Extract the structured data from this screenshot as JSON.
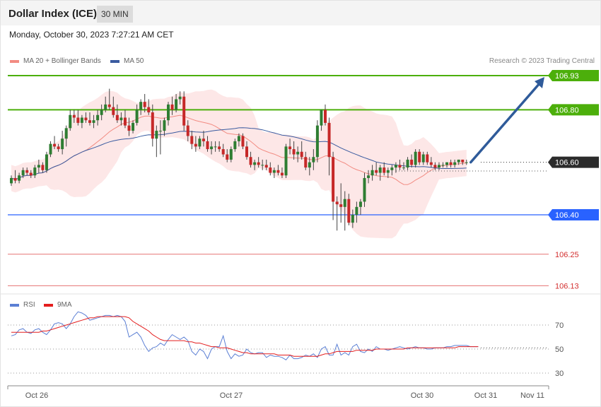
{
  "header": {
    "title": "Dollar Index (ICE)",
    "timeframe": "30 MIN"
  },
  "timestamp": "Monday, October 30, 2023 7:27:21 AM CET",
  "credit": "Research © 2023 Trading Central",
  "legend_main": [
    {
      "label": "MA 20 + Bollinger Bands",
      "color": "#f28b82"
    },
    {
      "label": "MA 50",
      "color": "#3a5ba0"
    }
  ],
  "legend_rsi": [
    {
      "label": "RSI",
      "color": "#5b7fd4"
    },
    {
      "label": "9MA",
      "color": "#e41e1e"
    }
  ],
  "colors": {
    "up": "#2e7d32",
    "down": "#c62828",
    "resistance": "#4caf0b",
    "support": "#2962ff",
    "target_line": "#e57373",
    "current": "#333333",
    "arrow": "#2f5b9a",
    "band": "#fde3e3"
  },
  "chart_data": [
    {
      "type": "candlestick",
      "ylim": [
        106.05,
        107.0
      ],
      "x_ticks": [
        "Oct 26",
        "Oct 27",
        "Oct 30",
        "Oct 31",
        "Nov 11"
      ],
      "levels": [
        {
          "label": "106.93",
          "value": 106.93,
          "kind": "resistance"
        },
        {
          "label": "106.80",
          "value": 106.8,
          "kind": "resistance"
        },
        {
          "label": "106.60",
          "value": 106.6,
          "kind": "current"
        },
        {
          "label": "106.40",
          "value": 106.4,
          "kind": "support"
        },
        {
          "label": "106.25",
          "value": 106.25,
          "kind": "target"
        },
        {
          "label": "106.13",
          "value": 106.13,
          "kind": "target"
        }
      ],
      "arrow": {
        "from_value": 106.6,
        "to_value": 106.93
      },
      "candles": [
        [
          106.52,
          106.55,
          106.51,
          106.54
        ],
        [
          106.54,
          106.57,
          106.52,
          106.53
        ],
        [
          106.53,
          106.56,
          106.52,
          106.55
        ],
        [
          106.55,
          106.58,
          106.54,
          106.57
        ],
        [
          106.57,
          106.58,
          106.55,
          106.56
        ],
        [
          106.56,
          106.57,
          106.54,
          106.55
        ],
        [
          106.55,
          106.59,
          106.54,
          106.58
        ],
        [
          106.58,
          106.61,
          106.56,
          106.59
        ],
        [
          106.59,
          106.6,
          106.56,
          106.57
        ],
        [
          106.57,
          106.64,
          106.56,
          106.63
        ],
        [
          106.63,
          106.68,
          106.62,
          106.67
        ],
        [
          106.67,
          106.7,
          106.65,
          106.66
        ],
        [
          106.66,
          106.67,
          106.64,
          106.65
        ],
        [
          106.65,
          106.72,
          106.63,
          106.69
        ],
        [
          106.69,
          106.74,
          106.66,
          106.73
        ],
        [
          106.73,
          106.8,
          106.72,
          106.78
        ],
        [
          106.78,
          106.8,
          106.75,
          106.77
        ],
        [
          106.77,
          106.8,
          106.74,
          106.75
        ],
        [
          106.75,
          106.78,
          106.73,
          106.77
        ],
        [
          106.77,
          106.79,
          106.75,
          106.76
        ],
        [
          106.76,
          106.79,
          106.74,
          106.75
        ],
        [
          106.75,
          106.78,
          106.73,
          106.76
        ],
        [
          106.76,
          106.8,
          106.74,
          106.78
        ],
        [
          106.78,
          106.82,
          106.76,
          106.8
        ],
        [
          106.8,
          106.85,
          106.79,
          106.82
        ],
        [
          106.82,
          106.88,
          106.8,
          106.81
        ],
        [
          106.81,
          106.85,
          106.77,
          106.78
        ],
        [
          106.78,
          106.82,
          106.75,
          106.76
        ],
        [
          106.76,
          106.79,
          106.74,
          106.77
        ],
        [
          106.77,
          106.8,
          106.73,
          106.74
        ],
        [
          106.74,
          106.77,
          106.7,
          106.72
        ],
        [
          106.72,
          106.76,
          106.71,
          106.75
        ],
        [
          106.75,
          106.82,
          106.74,
          106.8
        ],
        [
          106.8,
          106.84,
          106.78,
          106.83
        ],
        [
          106.83,
          106.86,
          106.79,
          106.81
        ],
        [
          106.81,
          106.84,
          106.78,
          106.79
        ],
        [
          106.79,
          106.82,
          106.66,
          106.69
        ],
        [
          106.69,
          106.74,
          106.62,
          106.72
        ],
        [
          106.72,
          106.76,
          106.63,
          106.72
        ],
        [
          106.72,
          106.77,
          106.7,
          106.76
        ],
        [
          106.76,
          106.83,
          106.74,
          106.82
        ],
        [
          106.82,
          106.85,
          106.78,
          106.8
        ],
        [
          106.8,
          106.86,
          106.79,
          106.84
        ],
        [
          106.84,
          106.87,
          106.82,
          106.85
        ],
        [
          106.85,
          106.87,
          106.72,
          106.74
        ],
        [
          106.74,
          106.76,
          106.68,
          106.7
        ],
        [
          106.7,
          106.72,
          106.65,
          106.67
        ],
        [
          106.67,
          106.7,
          106.64,
          106.66
        ],
        [
          106.66,
          106.7,
          106.65,
          106.69
        ],
        [
          106.69,
          106.72,
          106.66,
          106.68
        ],
        [
          106.68,
          106.7,
          106.64,
          106.65
        ],
        [
          106.65,
          106.68,
          106.63,
          106.66
        ],
        [
          106.66,
          106.68,
          106.64,
          106.66
        ],
        [
          106.66,
          106.68,
          106.64,
          106.65
        ],
        [
          106.65,
          106.67,
          106.62,
          106.63
        ],
        [
          106.63,
          106.65,
          106.6,
          106.61
        ],
        [
          106.61,
          106.66,
          106.6,
          106.65
        ],
        [
          106.65,
          106.69,
          106.64,
          106.68
        ],
        [
          106.68,
          106.71,
          106.66,
          106.7
        ],
        [
          106.7,
          106.71,
          106.65,
          106.66
        ],
        [
          106.66,
          106.68,
          106.61,
          106.62
        ],
        [
          106.62,
          106.64,
          106.58,
          106.59
        ],
        [
          106.59,
          106.61,
          106.57,
          106.6
        ],
        [
          106.6,
          106.62,
          106.58,
          106.59
        ],
        [
          106.59,
          106.61,
          106.57,
          106.59
        ],
        [
          106.59,
          106.61,
          106.57,
          106.58
        ],
        [
          106.58,
          106.6,
          106.55,
          106.56
        ],
        [
          106.56,
          106.58,
          106.54,
          106.57
        ],
        [
          106.57,
          106.59,
          106.55,
          106.56
        ],
        [
          106.56,
          106.58,
          106.54,
          106.55
        ],
        [
          106.55,
          106.67,
          106.54,
          106.66
        ],
        [
          106.66,
          106.69,
          106.63,
          106.65
        ],
        [
          106.65,
          106.68,
          106.61,
          106.63
        ],
        [
          106.63,
          106.66,
          106.6,
          106.64
        ],
        [
          106.64,
          106.68,
          106.61,
          106.62
        ],
        [
          106.62,
          106.64,
          106.57,
          106.58
        ],
        [
          106.58,
          106.62,
          106.55,
          106.6
        ],
        [
          106.6,
          106.65,
          106.57,
          106.62
        ],
        [
          106.62,
          106.76,
          106.6,
          106.74
        ],
        [
          106.74,
          106.8,
          106.72,
          106.8
        ],
        [
          106.8,
          106.82,
          106.74,
          106.75
        ],
        [
          106.75,
          106.77,
          106.55,
          106.62
        ],
        [
          106.62,
          106.64,
          106.38,
          106.45
        ],
        [
          106.45,
          106.47,
          106.34,
          106.44
        ],
        [
          106.44,
          106.52,
          106.37,
          106.43
        ],
        [
          106.43,
          106.49,
          106.34,
          106.46
        ],
        [
          106.46,
          106.48,
          106.36,
          106.37
        ],
        [
          106.37,
          106.42,
          106.35,
          106.4
        ],
        [
          106.4,
          106.45,
          106.37,
          106.43
        ],
        [
          106.43,
          106.46,
          106.4,
          106.45
        ],
        [
          106.45,
          106.56,
          106.43,
          106.54
        ],
        [
          106.54,
          106.57,
          106.52,
          106.55
        ],
        [
          106.55,
          106.59,
          106.53,
          106.57
        ],
        [
          106.57,
          106.6,
          106.55,
          106.56
        ],
        [
          106.56,
          106.59,
          106.53,
          106.58
        ],
        [
          106.58,
          106.6,
          106.55,
          106.56
        ],
        [
          106.56,
          106.58,
          106.54,
          106.57
        ],
        [
          106.57,
          106.59,
          106.55,
          106.58
        ],
        [
          106.58,
          106.6,
          106.56,
          106.59
        ],
        [
          106.59,
          106.61,
          106.57,
          106.58
        ],
        [
          106.58,
          106.6,
          106.57,
          106.58
        ],
        [
          106.58,
          106.62,
          106.57,
          106.61
        ],
        [
          106.61,
          106.63,
          106.58,
          106.59
        ],
        [
          106.59,
          106.65,
          106.58,
          106.64
        ],
        [
          106.64,
          106.65,
          106.59,
          106.6
        ],
        [
          106.6,
          106.64,
          106.59,
          106.63
        ],
        [
          106.63,
          106.64,
          106.59,
          106.6
        ],
        [
          106.6,
          106.62,
          106.58,
          106.59
        ],
        [
          106.59,
          106.6,
          106.57,
          106.58
        ],
        [
          106.58,
          106.6,
          106.57,
          106.59
        ],
        [
          106.59,
          106.6,
          106.58,
          106.59
        ],
        [
          106.59,
          106.6,
          106.58,
          106.6
        ],
        [
          106.6,
          106.61,
          106.58,
          106.59
        ],
        [
          106.59,
          106.61,
          106.58,
          106.6
        ],
        [
          106.6,
          106.61,
          106.59,
          106.61
        ],
        [
          106.61,
          106.61,
          106.59,
          106.6
        ],
        [
          106.6,
          106.61,
          106.59,
          106.6
        ]
      ]
    },
    {
      "type": "line",
      "name": "RSI",
      "ylim": [
        20,
        85
      ],
      "y_ticks": [
        70,
        50,
        30
      ],
      "series": [
        {
          "name": "RSI",
          "values": [
            61,
            62,
            66,
            67,
            64,
            63,
            66,
            67,
            64,
            62,
            66,
            71,
            72,
            71,
            67,
            71,
            77,
            81,
            80,
            78,
            74,
            75,
            76,
            77,
            78,
            78,
            77,
            78,
            77,
            73,
            60,
            62,
            64,
            60,
            53,
            48,
            51,
            52,
            55,
            53,
            58,
            62,
            60,
            58,
            60,
            57,
            48,
            45,
            50,
            48,
            42,
            50,
            52,
            52,
            61,
            48,
            42,
            46,
            44,
            45,
            50,
            47,
            46,
            47,
            47,
            43,
            45,
            44,
            44,
            43,
            41,
            45,
            42,
            42,
            43,
            45,
            44,
            46,
            43,
            50,
            52,
            45,
            45,
            54,
            45,
            47,
            45,
            52,
            54,
            48,
            47,
            50,
            48,
            52,
            50,
            50,
            49,
            50,
            51,
            52,
            51,
            50,
            51,
            52,
            51,
            51,
            50,
            50,
            51,
            51,
            51,
            52,
            52,
            53,
            53,
            53,
            53,
            52,
            52,
            52
          ]
        },
        {
          "name": "9MA",
          "values": [
            64,
            64,
            64,
            64,
            64,
            64,
            64,
            64,
            65,
            65,
            66,
            67,
            68,
            69,
            70,
            71,
            72,
            73,
            74,
            75,
            76,
            76,
            77,
            77,
            77,
            77,
            77,
            77,
            77,
            77,
            76,
            73,
            71,
            69,
            67,
            65,
            62,
            60,
            58,
            57,
            57,
            57,
            57,
            57,
            57,
            56,
            56,
            55,
            55,
            54,
            53,
            52,
            52,
            51,
            51,
            51,
            50,
            49,
            48,
            47,
            47,
            46,
            46,
            46,
            46,
            46,
            46,
            46,
            45,
            45,
            45,
            45,
            44,
            44,
            44,
            44,
            44,
            44,
            44,
            45,
            46,
            46,
            47,
            48,
            48,
            48,
            48,
            48,
            49,
            49,
            49,
            49,
            49,
            50,
            50,
            50,
            50,
            50,
            50,
            50,
            50,
            51,
            51,
            51,
            51,
            51,
            51,
            51,
            51,
            51,
            51,
            51,
            51,
            51,
            52,
            52,
            52,
            52,
            52,
            52
          ]
        }
      ]
    }
  ]
}
